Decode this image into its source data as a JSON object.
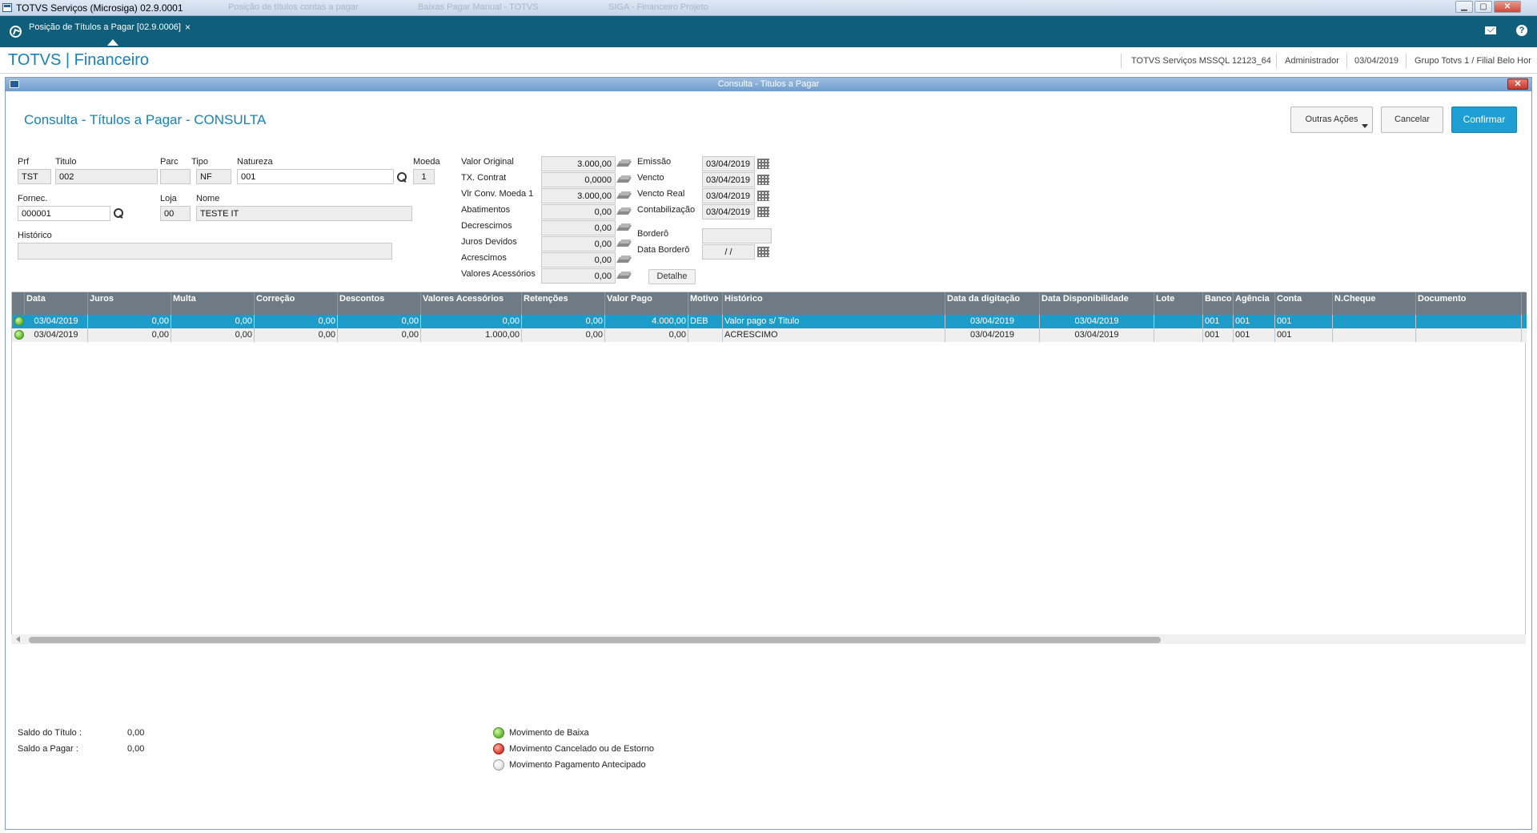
{
  "window": {
    "title": "TOTVS Serviços (Microsiga) 02.9.0001",
    "bg_tabs": [
      "Posição de títulos contas a pagar",
      "Baixas Pagar Manual - TOTVS",
      "SIGA - Financeiro Projeto"
    ],
    "buttons": {
      "minimize": "▁",
      "maximize": "▢",
      "close": "✕"
    }
  },
  "tabbar": {
    "tab_label": "Posição de Títulos a Pagar [02.9.0006]",
    "tab_close": "×",
    "help": "?"
  },
  "header": {
    "brand": "TOTVS | Financeiro",
    "server": "TOTVS Serviços MSSQL 12123_64",
    "user": "Administrador",
    "date": "03/04/2019",
    "group": "Grupo Totvs 1 / Filial Belo Hor"
  },
  "dialog": {
    "title": "Consulta - Titulos a Pagar",
    "close": "✕",
    "page_title": "Consulta - Títulos a Pagar - CONSULTA",
    "actions": {
      "other": "Outras Ações",
      "cancel": "Cancelar",
      "confirm": "Confirmar"
    }
  },
  "form": {
    "prf": {
      "label": "Prf",
      "value": "TST"
    },
    "titulo": {
      "label": "Titulo",
      "value": "002"
    },
    "parc": {
      "label": "Parc",
      "value": ""
    },
    "tipo": {
      "label": "Tipo",
      "value": "NF"
    },
    "natureza": {
      "label": "Natureza",
      "value": "001"
    },
    "moeda": {
      "label": "Moeda",
      "value": "1"
    },
    "fornec": {
      "label": "Fornec.",
      "value": "000001"
    },
    "loja": {
      "label": "Loja",
      "value": "00"
    },
    "nome": {
      "label": "Nome",
      "value": "TESTE IT"
    },
    "historico": {
      "label": "Histórico",
      "value": ""
    }
  },
  "values": [
    {
      "label": "Valor Original",
      "value": "3.000,00"
    },
    {
      "label": "TX. Contrat",
      "value": "0,0000"
    },
    {
      "label": "Vlr Conv. Moeda 1",
      "value": "3.000,00"
    },
    {
      "label": "Abatimentos",
      "value": "0,00"
    },
    {
      "label": "Decrescimos",
      "value": "0,00"
    },
    {
      "label": "Juros Devidos",
      "value": "0,00"
    },
    {
      "label": "Acrescimos",
      "value": "0,00"
    },
    {
      "label": "Valores Acessórios",
      "value": "0,00"
    }
  ],
  "detalhe_button": "Detalhe",
  "dates": [
    {
      "label": "Emissão",
      "value": "03/04/2019"
    },
    {
      "label": "Vencto",
      "value": "03/04/2019"
    },
    {
      "label": "Vencto Real",
      "value": "03/04/2019"
    },
    {
      "label": "Contabilização",
      "value": "03/04/2019"
    }
  ],
  "bordero": {
    "label": "Borderô",
    "value": ""
  },
  "data_bordero": {
    "label": "Data Borderô",
    "value": "  /  /"
  },
  "grid": {
    "columns": [
      "Data",
      "Juros",
      "Multa",
      "Correção",
      "Descontos",
      "Valores Acessórios",
      "Retenções",
      "Valor Pago",
      "Motivo",
      "Histórico",
      "Data da digitação",
      "Data Disponibilidade",
      "Lote",
      "Banco",
      "Agência",
      "Conta",
      "N.Cheque",
      "Documento"
    ],
    "rows": [
      [
        "03/04/2019",
        "0,00",
        "0,00",
        "0,00",
        "0,00",
        "0,00",
        "0,00",
        "4.000,00",
        "DEB",
        "Valor pago s/ Titulo",
        "03/04/2019",
        "03/04/2019",
        "",
        "001",
        "001",
        "001",
        "",
        ""
      ],
      [
        "03/04/2019",
        "0,00",
        "0,00",
        "0,00",
        "0,00",
        "1.000,00",
        "0,00",
        "0,00",
        "",
        "ACRESCIMO",
        "03/04/2019",
        "03/04/2019",
        "",
        "001",
        "001",
        "001",
        "",
        ""
      ]
    ],
    "row_status": [
      "baixa",
      "baixa"
    ]
  },
  "footer": {
    "saldo_titulo": {
      "label": "Saldo do Título :",
      "value": "0,00"
    },
    "saldo_pagar": {
      "label": "Saldo a Pagar   :",
      "value": "0,00"
    }
  },
  "legend": [
    {
      "label": "Movimento de Baixa",
      "color": "#6cc13d"
    },
    {
      "label": "Movimento Cancelado ou de Estorno",
      "color": "#e0453a"
    },
    {
      "label": "Movimento Pagamento Antecipado",
      "color": "#e6e6e6"
    }
  ],
  "colors": {
    "accent": "#1583b8",
    "tabbar": "#0f5e7b",
    "primary_button": "#1e9fd3",
    "selected_row": "#1d9bc9",
    "grid_header": "#6e7b84"
  }
}
